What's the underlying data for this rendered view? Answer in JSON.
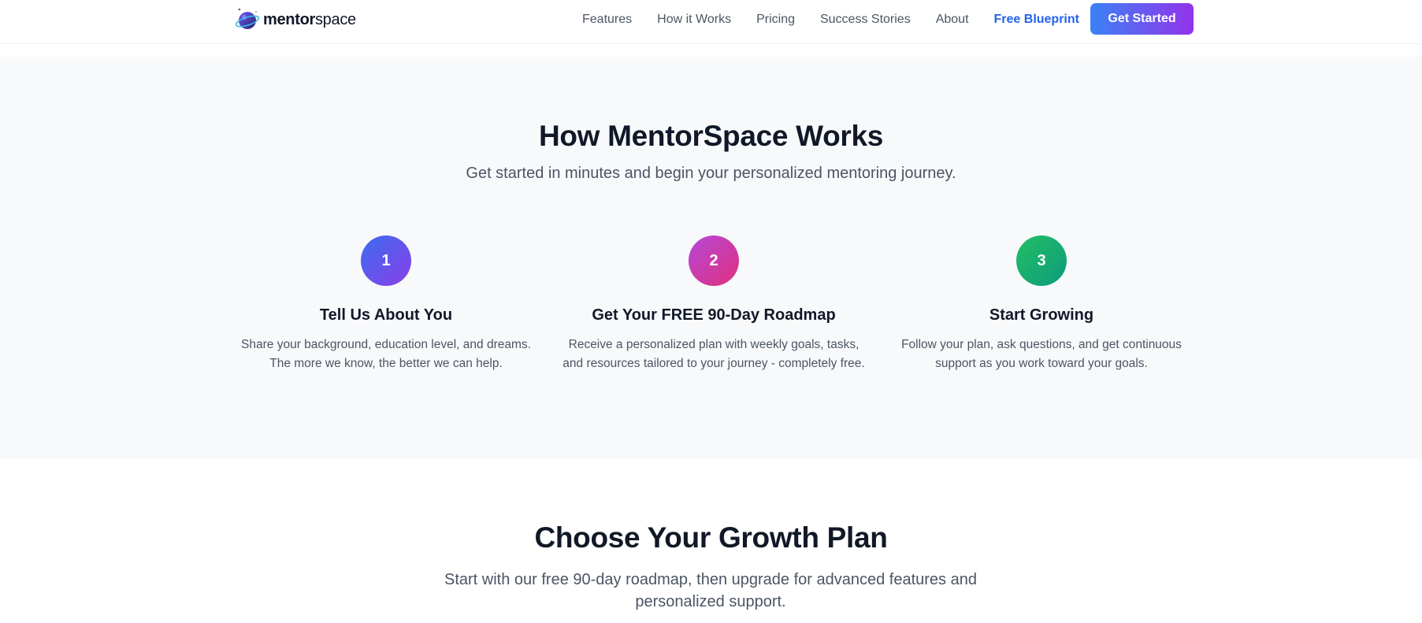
{
  "nav": {
    "logo": {
      "bold": "mentor",
      "light": "space"
    },
    "links": [
      "Features",
      "How it Works",
      "Pricing",
      "Success Stories",
      "About"
    ],
    "highlight_link": "Free Blueprint",
    "cta": "Get Started"
  },
  "how": {
    "title": "How MentorSpace Works",
    "subtitle": "Get started in minutes and begin your personalized mentoring journey.",
    "steps": [
      {
        "number": "1",
        "title": "Tell Us About You",
        "description": "Share your background, education level, and dreams. The more we know, the better we can help."
      },
      {
        "number": "2",
        "title": "Get Your FREE 90-Day Roadmap",
        "description": "Receive a personalized plan with weekly goals, tasks, and resources tailored to your journey - completely free."
      },
      {
        "number": "3",
        "title": "Start Growing",
        "description": "Follow your plan, ask questions, and get continuous support as you work toward your goals."
      }
    ]
  },
  "plans": {
    "title": "Choose Your Growth Plan",
    "subtitle": "Start with our free 90-day roadmap, then upgrade for advanced features and personalized support."
  },
  "colors": {
    "accent_blue": "#2563eb",
    "gradient_start": "#3b82f6",
    "gradient_end": "#9333ea",
    "step1": "#5b55ee",
    "step2": "#cc3cab",
    "step3": "#16a872"
  }
}
